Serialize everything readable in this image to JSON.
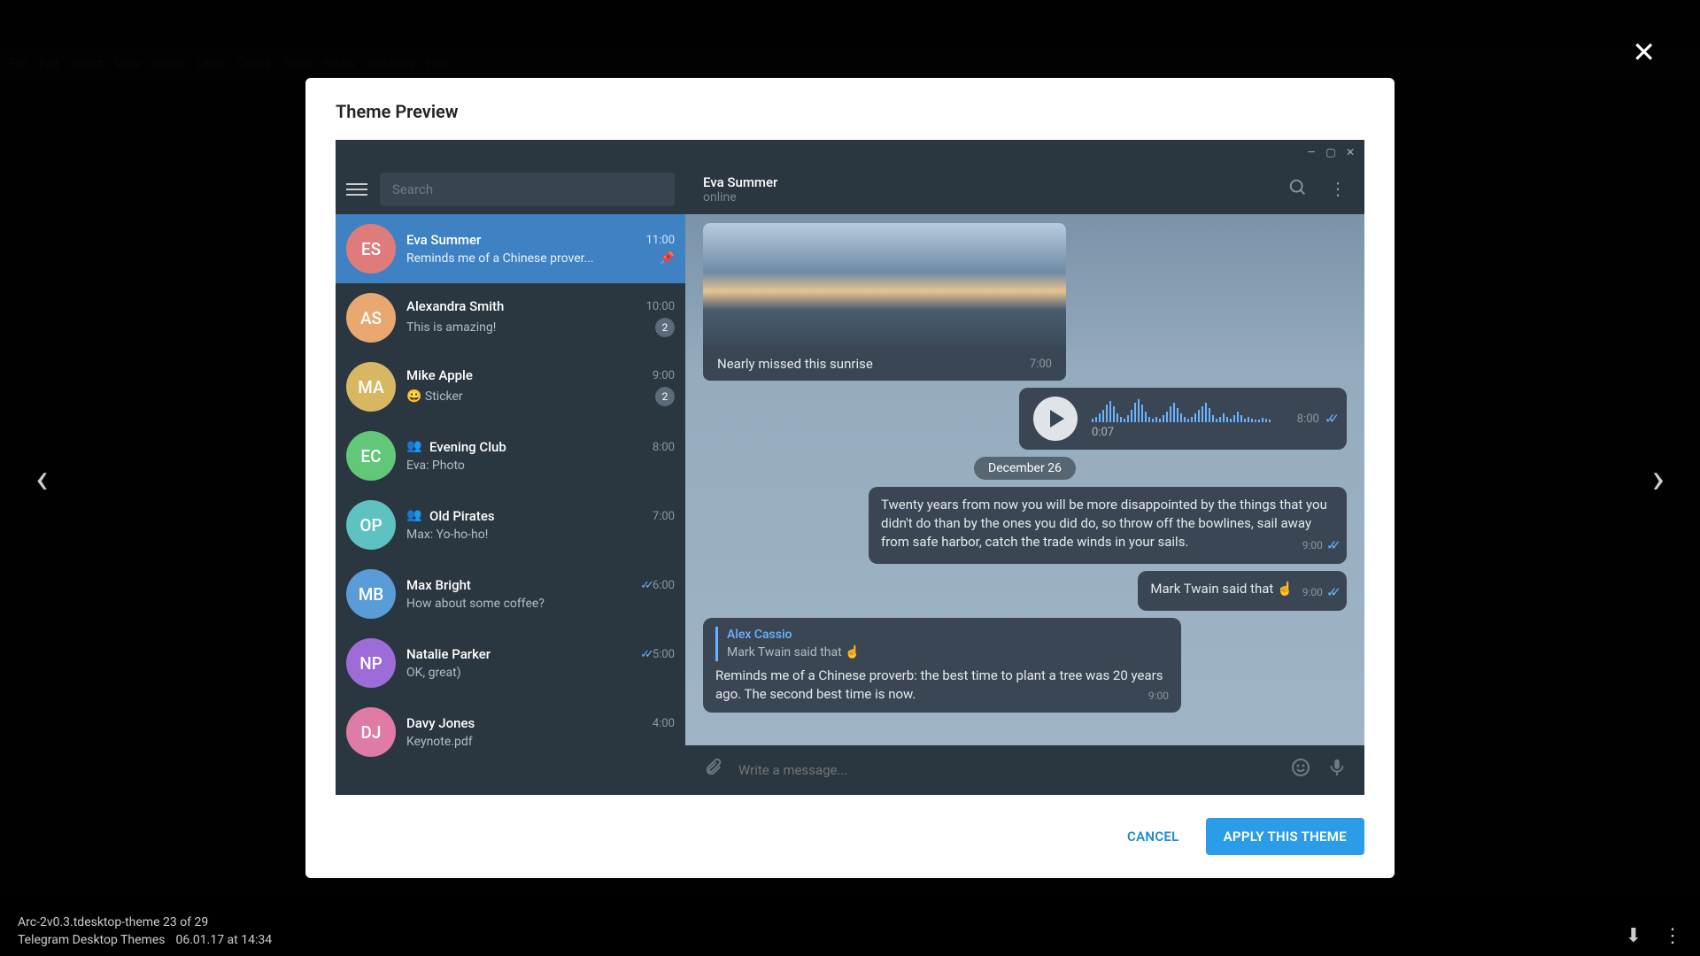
{
  "lightbox": {
    "filename": "Arc-2v0.3.tdesktop-theme 23 of 29",
    "collection": "Telegram Desktop Themes",
    "datetime": "06.01.17 at 14:34"
  },
  "modal": {
    "title": "Theme Preview",
    "buttons": {
      "cancel": "CANCEL",
      "apply": "APPLY THIS THEME"
    }
  },
  "preview": {
    "search_placeholder": "Search",
    "header": {
      "name": "Eva Summer",
      "status": "online"
    },
    "chats": [
      {
        "initials": "ES",
        "color": "#e07b7b",
        "name": "Eva Summer",
        "msg": "Reminds me of a Chinese prover...",
        "time": "11:00",
        "active": true,
        "pinned": true
      },
      {
        "initials": "AS",
        "color": "#e8a86f",
        "name": "Alexandra Smith",
        "msg": "This is amazing!",
        "time": "10:00",
        "badge": "2"
      },
      {
        "initials": "MA",
        "color": "#d8b763",
        "name": "Mike Apple",
        "msg": "😀 Sticker",
        "time": "9:00",
        "badge": "2"
      },
      {
        "initials": "EC",
        "color": "#63c77a",
        "name": "Evening Club",
        "msg": "Eva: Photo",
        "time": "8:00",
        "group": true
      },
      {
        "initials": "OP",
        "color": "#5fc2c2",
        "name": "Old Pirates",
        "msg": "Max: Yo-ho-ho!",
        "time": "7:00",
        "group": true
      },
      {
        "initials": "MB",
        "color": "#5a9cd8",
        "name": "Max Bright",
        "msg": "How about some coffee?",
        "time": "6:00",
        "read": true
      },
      {
        "initials": "NP",
        "color": "#9d6cd8",
        "name": "Natalie Parker",
        "msg": "OK, great)",
        "time": "5:00",
        "read": true
      },
      {
        "initials": "DJ",
        "color": "#e07ba6",
        "name": "Davy Jones",
        "msg": "Keynote.pdf",
        "time": "4:00"
      }
    ],
    "messages": {
      "img_caption": "Nearly missed this sunrise",
      "img_time": "7:00",
      "voice_dur": "0:07",
      "voice_time": "8:00",
      "date": "December 26",
      "quote": "Twenty years from now you will be more disappointed by the things that you didn't do than by the ones you did do, so throw off the bowlines, sail away from safe harbor, catch the trade winds in your sails.",
      "quote_time": "9:00",
      "twain": "Mark Twain said that ☝",
      "twain_time": "9:00",
      "reply_name": "Alex Cassio",
      "reply_quote": "Mark Twain said that ☝",
      "reply_body": "Reminds me of a Chinese proverb: the best time to plant a tree was 20 years ago. The second best time is now.",
      "reply_time": "9:00",
      "compose_placeholder": "Write a message..."
    }
  },
  "bg_menu": [
    "File",
    "Edit",
    "Select",
    "View",
    "Image",
    "Layer",
    "Colors",
    "Tools",
    "Filters",
    "Windows",
    "Help"
  ]
}
